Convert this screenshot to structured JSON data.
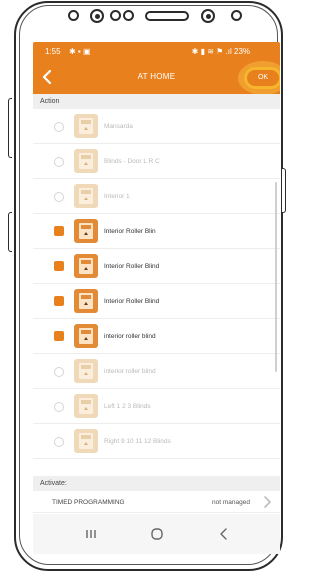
{
  "status_bar": {
    "time": "1:55",
    "left_icons": "✱ ▪ ▣",
    "right_icons": "✱ ▮ ≋ ⚑ .ıl 23%"
  },
  "app_bar": {
    "title": "AT HOME",
    "ok_label": "OK",
    "back_icon": "chevron-left-icon"
  },
  "action_header": "Action",
  "items": [
    {
      "label": "Mansarda",
      "selected": false
    },
    {
      "label": "Blinds - Door L R C",
      "selected": false
    },
    {
      "label": "Interior 1",
      "selected": false
    },
    {
      "label": "Interior Roller Blin",
      "selected": true
    },
    {
      "label": "Interior Roller Blind",
      "selected": true
    },
    {
      "label": "Interior Roller Blind",
      "selected": true
    },
    {
      "label": "interior roller blind",
      "selected": true
    },
    {
      "label": "interior roller blind",
      "selected": false
    },
    {
      "label": "Left 1 2 3 Blinds",
      "selected": false
    },
    {
      "label": "Right 9 10 11 12 Blinds",
      "selected": false
    }
  ],
  "activate_header": "Activate:",
  "timed": {
    "label": "TIMED PROGRAMMING",
    "value": "not managed"
  },
  "colors": {
    "accent": "#e8811d",
    "highlight": "#f5b52c"
  }
}
